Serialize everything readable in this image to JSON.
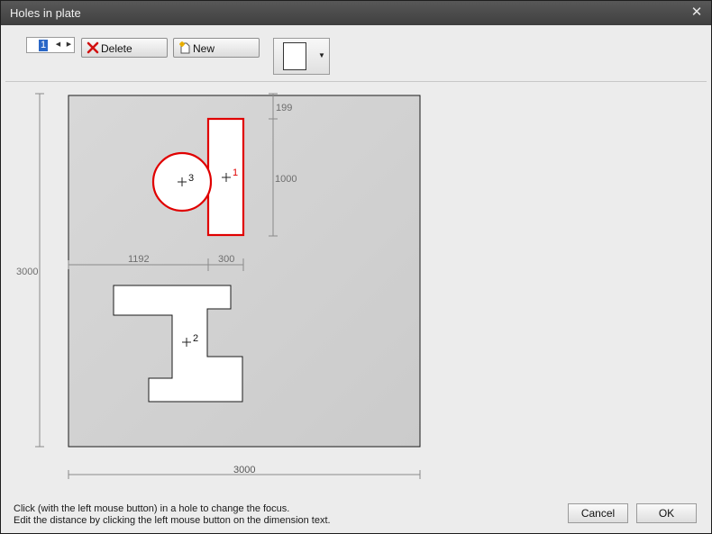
{
  "window": {
    "title": "Holes in plate",
    "close_glyph": "✕"
  },
  "toolbar": {
    "hole_index": "1",
    "delete_label": "Delete",
    "new_label": "New",
    "delete_icon": "red-x-icon",
    "new_icon": "new-document-icon"
  },
  "dimensions": {
    "plate_width": "3000",
    "plate_height": "3000",
    "offset_x": "1192",
    "hole_width": "300",
    "offset_top": "199",
    "hole_height": "1000"
  },
  "holes": [
    {
      "id": "1"
    },
    {
      "id": "2"
    },
    {
      "id": "3"
    }
  ],
  "footer": {
    "hint_line1": "Click (with the left mouse button) in a hole to change the focus.",
    "hint_line2": "Edit the distance by clicking the left mouse button on the dimension text.",
    "cancel_label": "Cancel",
    "ok_label": "OK"
  },
  "colors": {
    "selected_hole": "#e00000",
    "plate": "#d4d4d4",
    "dimension_line": "#8a8a8a"
  }
}
